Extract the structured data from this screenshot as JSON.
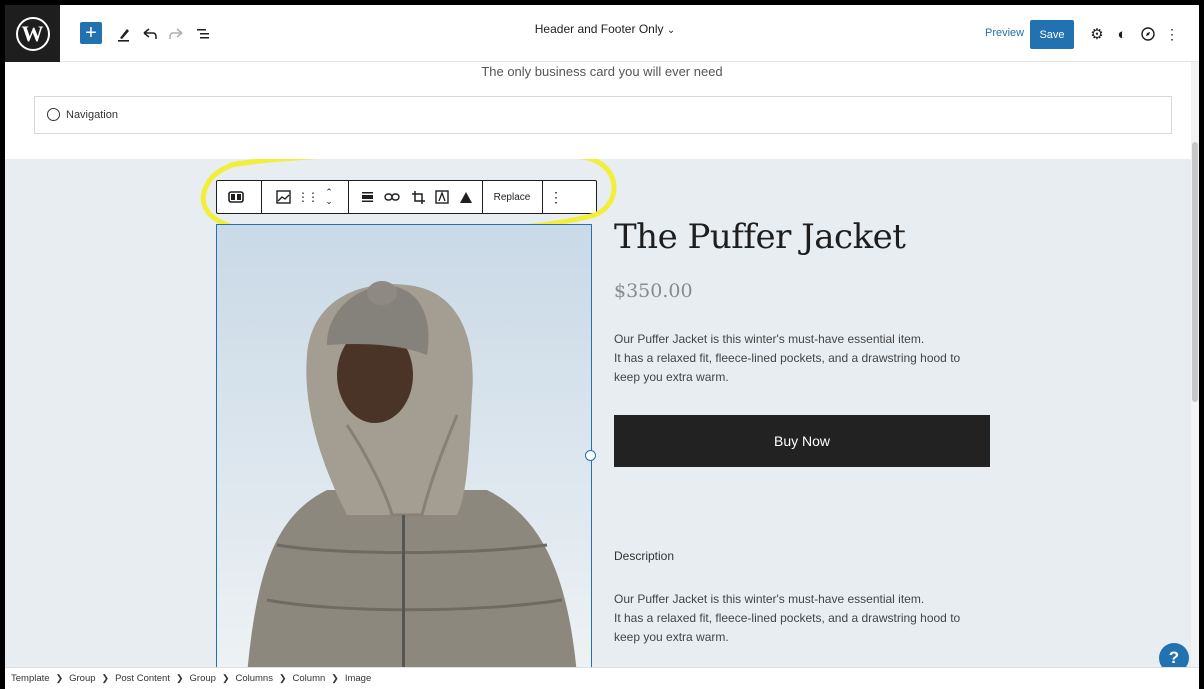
{
  "topbar": {
    "template_title": "Header and Footer Only",
    "preview_label": "Preview",
    "save_label": "Save"
  },
  "header": {
    "tagline": "The only business card you will ever need",
    "navigation_label": "Navigation"
  },
  "toolbar": {
    "replace_label": "Replace"
  },
  "product": {
    "title": "The Puffer Jacket",
    "price": "$350.00",
    "description_line1": "Our Puffer Jacket is this winter's must-have essential item.",
    "description_line2": "It has a relaxed fit, fleece-lined pockets, and a drawstring hood to",
    "description_line3": "keep you extra warm.",
    "buy_label": "Buy Now",
    "description_heading": "Description",
    "description2_line1": "Our Puffer Jacket is this winter's must-have essential item.",
    "description2_line2": "It has a relaxed fit, fleece-lined pockets, and a drawstring hood to",
    "description2_line3": "keep you extra warm."
  },
  "breadcrumb": [
    "Template",
    "Group",
    "Post Content",
    "Group",
    "Columns",
    "Column",
    "Image"
  ],
  "help_label": "?",
  "colors": {
    "accent": "#2271b1",
    "canvas": "#e8edf1",
    "highlight": "#f2ef3b"
  }
}
